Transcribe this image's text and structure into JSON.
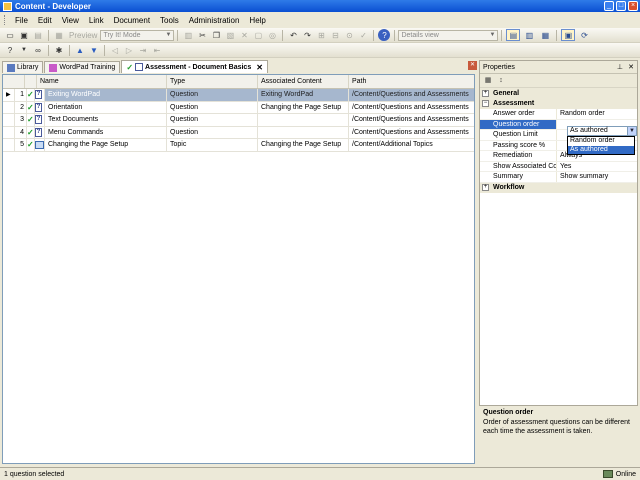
{
  "window": {
    "title": "Content - Developer"
  },
  "menu": [
    "File",
    "Edit",
    "View",
    "Link",
    "Document",
    "Tools",
    "Administration",
    "Help"
  ],
  "toolbar": {
    "preview_label": "Preview",
    "mode_combo": "Try It! Mode",
    "view_combo": "Details view"
  },
  "tabs": [
    {
      "label": "Library",
      "icon": "library-icon",
      "active": false
    },
    {
      "label": "WordPad Training",
      "icon": "outline-icon",
      "active": false
    },
    {
      "label": "Assessment - Document Basics",
      "icon": "assessment-icon",
      "active": true
    }
  ],
  "grid": {
    "columns": [
      "Name",
      "Type",
      "Associated Content",
      "Path"
    ],
    "rows": [
      {
        "num": "1",
        "name": "Exiting WordPad",
        "type": "Question",
        "assoc": "Exiting WordPad",
        "path": "/Content/Questions and Assessments",
        "icon": "question-icon",
        "selected": true
      },
      {
        "num": "2",
        "name": "Orientation",
        "type": "Question",
        "assoc": "Changing the Page Setup",
        "path": "/Content/Questions and Assessments",
        "icon": "question-icon",
        "selected": false
      },
      {
        "num": "3",
        "name": "Text Documents",
        "type": "Question",
        "assoc": "",
        "path": "/Content/Questions and Assessments",
        "icon": "question-icon",
        "selected": false
      },
      {
        "num": "4",
        "name": "Menu Commands",
        "type": "Question",
        "assoc": "",
        "path": "/Content/Questions and Assessments",
        "icon": "question-icon",
        "selected": false
      },
      {
        "num": "5",
        "name": "Changing the Page Setup",
        "type": "Topic",
        "assoc": "Changing the Page Setup",
        "path": "/Content/Additional Topics",
        "icon": "topic-icon",
        "selected": false
      }
    ]
  },
  "properties": {
    "title": "Properties",
    "categories": {
      "general": "General",
      "assessment": "Assessment",
      "workflow": "Workflow"
    },
    "rows": [
      {
        "name": "Answer order",
        "value": "Random order"
      },
      {
        "name": "Question order",
        "value": "As authored"
      },
      {
        "name": "Question Limit",
        "value": ""
      },
      {
        "name": "Passing score %",
        "value": ""
      },
      {
        "name": "Remediation",
        "value": "Always"
      },
      {
        "name": "Show Associated Co...",
        "value": "Yes"
      },
      {
        "name": "Summary",
        "value": "Show summary"
      }
    ],
    "dropdown": {
      "value": "As authored",
      "options": [
        "Random order",
        "As authored"
      ]
    },
    "description": {
      "title": "Question order",
      "text": "Order of assessment questions can be different each time the assessment is taken."
    }
  },
  "status": {
    "left": "1 question selected",
    "right": "Online"
  },
  "colors": {
    "titlebar": "#0A4FD2",
    "selection": "#316AC5",
    "row_selected": "#A6B7CE",
    "check": "#1E9E2A"
  }
}
